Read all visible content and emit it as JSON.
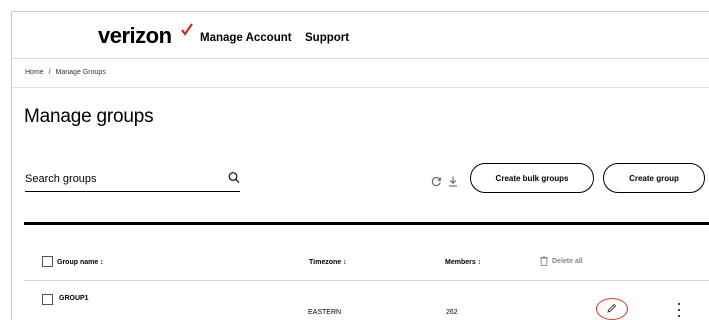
{
  "header": {
    "logo_text": "verizon",
    "brand_check_color": "#d52b1e",
    "nav": [
      "Manage Account",
      "Support"
    ]
  },
  "breadcrumb": {
    "home": "Home",
    "separator": "/",
    "current": "Manage Groups"
  },
  "page": {
    "title": "Manage groups"
  },
  "search": {
    "placeholder": "Search groups",
    "value": "",
    "icon": "search-icon"
  },
  "toolbar": {
    "refresh_icon": "refresh-icon",
    "download_icon": "download-icon",
    "bulk_label": "Create bulk groups",
    "create_label": "Create group"
  },
  "table": {
    "columns": [
      "Group name ↕",
      "Timezone ↕",
      "Members ↕"
    ],
    "delete_all_label": "Delete all",
    "rows": [
      {
        "name": "GROUP1",
        "timezone": "EASTERN",
        "members": "262"
      }
    ]
  },
  "annotation": {
    "color": "#d9312b"
  }
}
